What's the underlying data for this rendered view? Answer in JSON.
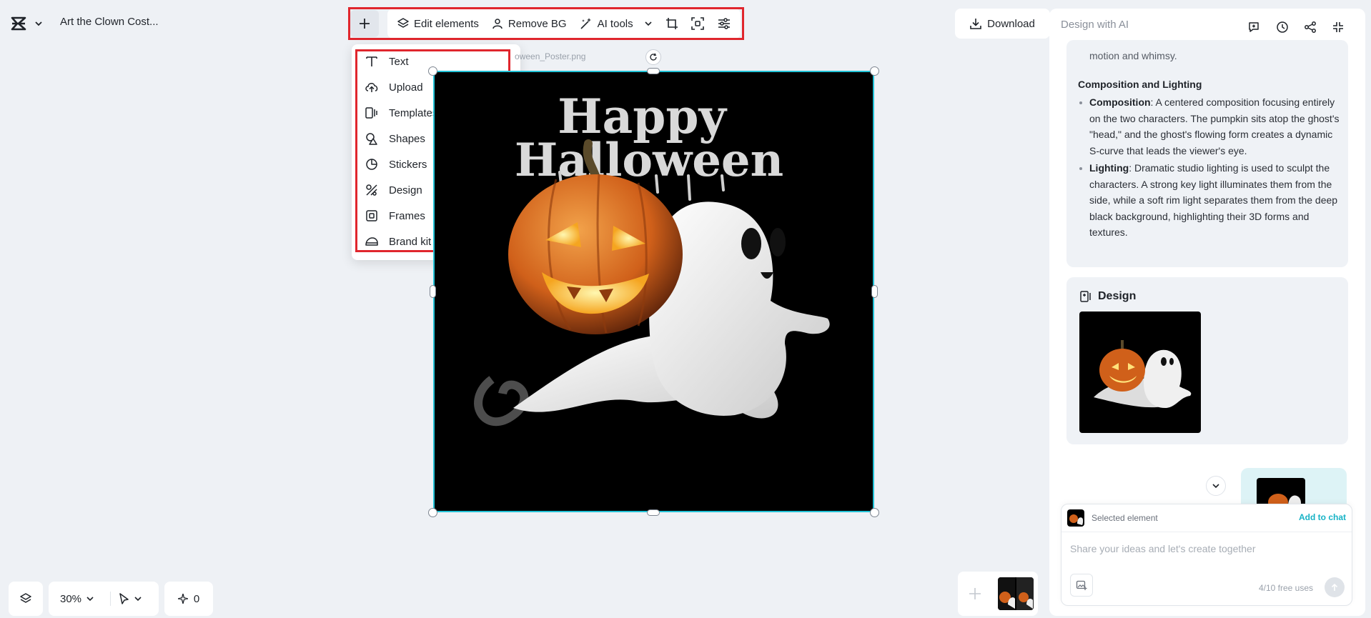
{
  "header": {
    "doc_title": "Art the Clown Cost..."
  },
  "toolbar": {
    "edit_elements": "Edit elements",
    "remove_bg": "Remove BG",
    "ai_tools": "AI tools"
  },
  "add_menu": {
    "items": [
      {
        "label": "Text",
        "icon": "text-icon"
      },
      {
        "label": "Upload",
        "icon": "upload-icon"
      },
      {
        "label": "Templates",
        "icon": "templates-icon"
      },
      {
        "label": "Shapes",
        "icon": "shapes-icon"
      },
      {
        "label": "Stickers",
        "icon": "stickers-icon"
      },
      {
        "label": "Design",
        "icon": "design-icon"
      },
      {
        "label": "Frames",
        "icon": "frames-icon"
      },
      {
        "label": "Brand kit",
        "icon": "brand-kit-icon"
      }
    ]
  },
  "canvas": {
    "file_label": "oween_Poster.png",
    "poster_text_line1": "Happy",
    "poster_text_line2": "Halloween"
  },
  "download_label": "Download",
  "panel": {
    "title": "Design with AI",
    "lead_text": "motion and whimsy.",
    "section_heading": "Composition and Lighting",
    "bullets": [
      {
        "term": "Composition",
        "text": ": A centered composition focusing entirely on the two characters. The pumpkin sits atop the ghost's \"head,\" and the ghost's flowing form creates a dynamic S-curve that leads the viewer's eye."
      },
      {
        "term": "Lighting",
        "text": ": Dramatic studio lighting is used to sculpt the characters. A strong key light illuminates them from the side, while a soft rim light separates them from the deep black background, highlighting their 3D forms and textures."
      }
    ],
    "design_card_title": "Design"
  },
  "composer": {
    "selected_element": "Selected element",
    "add_to_chat": "Add to chat",
    "placeholder": "Share your ideas and let's create together",
    "free_uses": "4/10 free uses"
  },
  "bottom": {
    "zoom": "30%",
    "credits": "0"
  },
  "colors": {
    "accent": "#22c2d6",
    "highlight": "#e0262d",
    "link": "#17b3c6"
  }
}
